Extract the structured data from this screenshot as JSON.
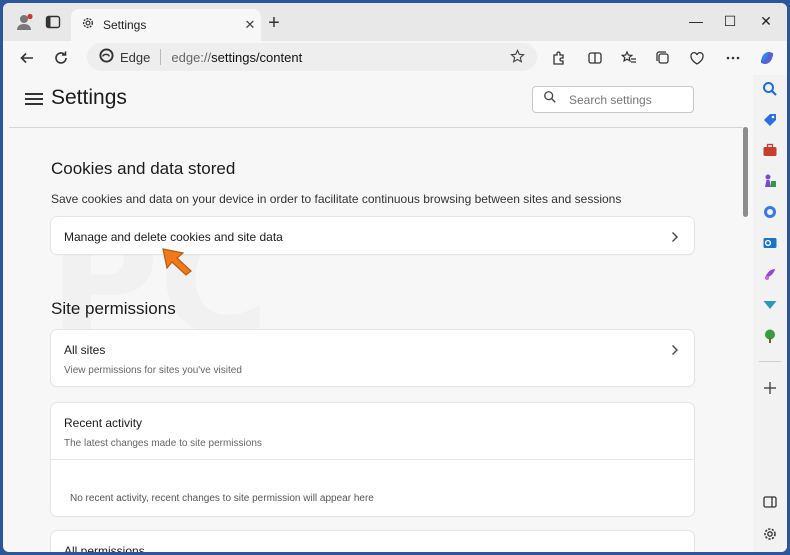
{
  "tab": {
    "title": "Settings",
    "close_glyph": "✕"
  },
  "new_tab_glyph": "+",
  "window_controls": {
    "minimize": "—",
    "maximize": "☐",
    "close": "✕"
  },
  "address": {
    "brand": "Edge",
    "protocol": "edge://",
    "path": "settings/content"
  },
  "page": {
    "title": "Settings",
    "search_placeholder": "Search settings"
  },
  "cookies": {
    "title": "Cookies and data stored",
    "description": "Save cookies and data on your device in order to facilitate continuous browsing between sites and sessions",
    "manage_label": "Manage and delete cookies and site data"
  },
  "permissions": {
    "title": "Site permissions",
    "all_sites": {
      "title": "All sites",
      "subtitle": "View permissions for sites you've visited"
    },
    "recent": {
      "title": "Recent activity",
      "subtitle": "The latest changes made to site permissions",
      "empty": "No recent activity, recent changes to site permission will appear here"
    },
    "next_partial": "All permissions"
  },
  "colors": {
    "frame": "#2b579a",
    "cursor": "#f07a1a",
    "profile_badge": "#d9342b"
  },
  "icons": {
    "sidebar": [
      "search-icon",
      "tag-icon",
      "toolbox-icon",
      "chess-icon",
      "office-icon",
      "outlook-icon",
      "games-icon",
      "send-icon",
      "tree-icon",
      "add-icon",
      "sidebar-toggle-icon",
      "settings-icon"
    ]
  }
}
